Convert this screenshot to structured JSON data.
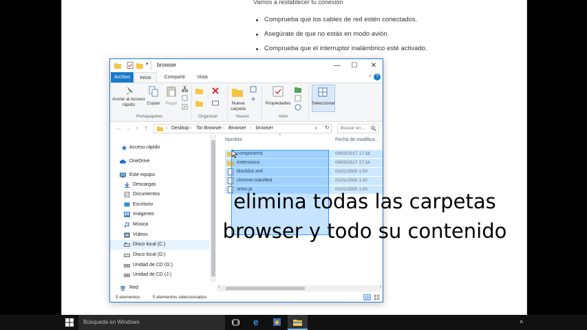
{
  "web_page": {
    "heading": "Vamos a restablecer tu conexión",
    "bullets": [
      "Comprueba que los cables de red estén conectados.",
      "Asegúrate de que no estás en modo avión.",
      "Comprueba que el interruptor inalámbrico esté activado."
    ]
  },
  "explorer": {
    "title": "browser",
    "window_controls": {
      "minimize": "—",
      "maximize": "☐",
      "close": "✕"
    },
    "tabs": [
      "Archivo",
      "Inicio",
      "Compartir",
      "Vista"
    ],
    "ribbon": {
      "pin_label": "Anclar al Acceso rápido",
      "copy_label": "Copiar",
      "paste_label": "Pegar",
      "new_folder_label": "Nueva carpeta",
      "properties_label": "Propiedades",
      "select_label": "Seleccionar",
      "groups": [
        "Portapapeles",
        "Organizar",
        "Nuevo",
        "Abrir"
      ]
    },
    "address": {
      "path": [
        "Desktop",
        "Tor Browser",
        "Browser",
        "browser"
      ],
      "search_placeholder": "Buscar en ..."
    },
    "nav_items": [
      {
        "label": "Acceso rápido",
        "icon": "star-icon"
      },
      {
        "label": "OneDrive",
        "icon": "cloud-icon"
      },
      {
        "label": "Este equipo",
        "icon": "computer-icon"
      },
      {
        "label": "Descargas",
        "icon": "download-icon"
      },
      {
        "label": "Documentos",
        "icon": "document-icon"
      },
      {
        "label": "Escritorio",
        "icon": "desktop-icon"
      },
      {
        "label": "Imágenes",
        "icon": "image-icon"
      },
      {
        "label": "Música",
        "icon": "music-icon"
      },
      {
        "label": "Vídeos",
        "icon": "video-icon"
      },
      {
        "label": "Disco local (C:)",
        "icon": "drive-icon"
      },
      {
        "label": "Disco local (D:)",
        "icon": "drive-icon"
      },
      {
        "label": "Unidad de CD (G:)",
        "icon": "cd-drive-icon"
      },
      {
        "label": "Unidad de CD (J:)",
        "icon": "cd-drive-icon"
      },
      {
        "label": "Red",
        "icon": "network-icon"
      }
    ],
    "columns": {
      "name": "Nombre",
      "date": "Fecha de modifica..."
    },
    "files": [
      {
        "name": "components",
        "date": "09/03/2017 17:18",
        "type": "folder"
      },
      {
        "name": "extensions",
        "date": "09/03/2017 17:18",
        "type": "folder"
      },
      {
        "name": "blocklist.xml",
        "date": "01/01/2000 1:00",
        "type": "file"
      },
      {
        "name": "chrome.manifest",
        "date": "01/01/2000 1:00",
        "type": "file"
      },
      {
        "name": "omni.ja",
        "date": "01/01/2000 1:00",
        "type": "file"
      }
    ],
    "status": {
      "count": "5 elementos",
      "selected": "5 elementos seleccionados"
    }
  },
  "subtitle": "elimina todas las carpetas browser y todo su contenido",
  "taskbar": {
    "search_placeholder": "Búsqueda en Windows"
  },
  "colors": {
    "accent": "#1979ca",
    "selection": "#cce8ff",
    "folder": "#f4c542"
  }
}
